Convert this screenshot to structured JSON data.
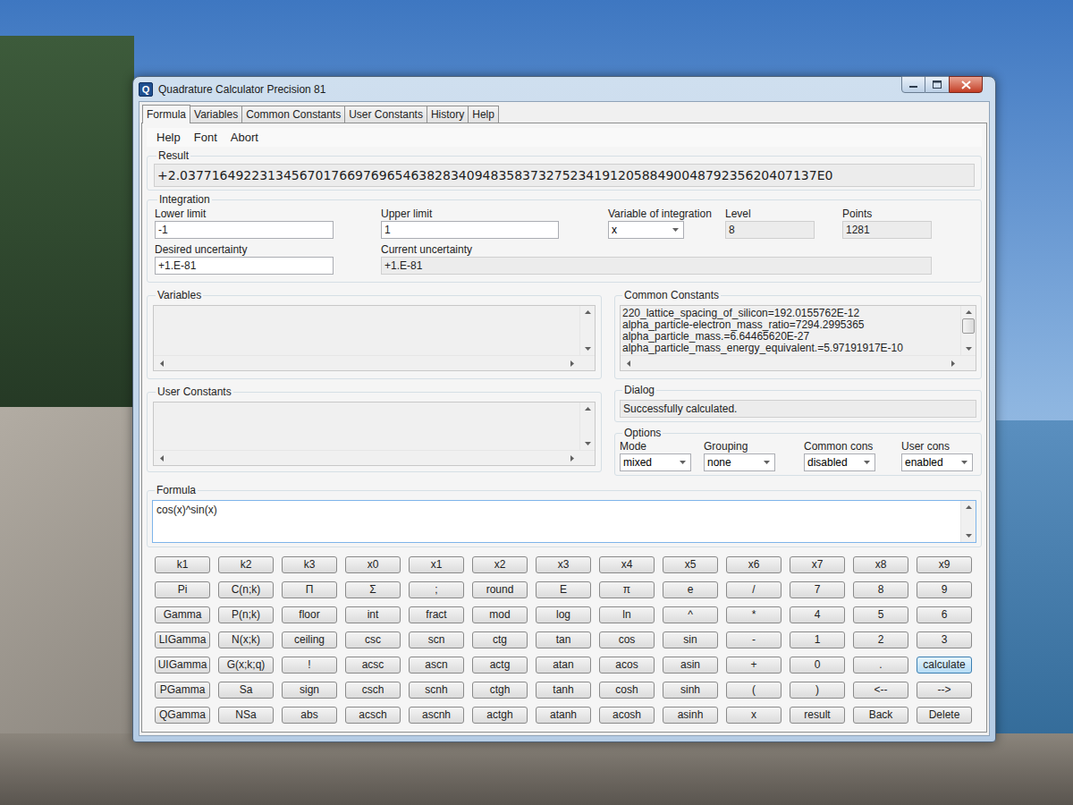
{
  "window": {
    "title": "Quadrature Calculator Precision 81",
    "icon": "Q"
  },
  "tabs": [
    {
      "label": "Formula",
      "selected": true
    },
    {
      "label": "Variables",
      "selected": false
    },
    {
      "label": "Common Constants",
      "selected": false
    },
    {
      "label": "User Constants",
      "selected": false
    },
    {
      "label": "History",
      "selected": false
    },
    {
      "label": "Help",
      "selected": false
    }
  ],
  "menu": [
    "Help",
    "Font",
    "Abort"
  ],
  "result": {
    "label": "Result",
    "value": "+2.03771649223134567017669769654638283409483583732752341912058849004879235620407137E0"
  },
  "integration": {
    "label": "Integration",
    "lower_limit": {
      "label": "Lower limit",
      "value": "-1"
    },
    "upper_limit": {
      "label": "Upper limit",
      "value": "1"
    },
    "variable": {
      "label": "Variable of integration",
      "value": "x"
    },
    "level": {
      "label": "Level",
      "value": "8"
    },
    "points": {
      "label": "Points",
      "value": "1281"
    },
    "desired_uncertainty": {
      "label": "Desired uncertainty",
      "value": "+1.E-81"
    },
    "current_uncertainty": {
      "label": "Current uncertainty",
      "value": "+1.E-81"
    }
  },
  "variables": {
    "label": "Variables",
    "items": [],
    "scrollable": false
  },
  "common_constants": {
    "label": "Common Constants",
    "items": [
      "220_lattice_spacing_of_silicon=192.0155762E-12",
      "alpha_particle-electron_mass_ratio=7294.2995365",
      "alpha_particle_mass.=6.64465620E-27",
      "alpha_particle_mass_energy_equivalent.=5.97191917E-10"
    ],
    "scrollable": true
  },
  "user_constants": {
    "label": "User Constants",
    "items": [],
    "scrollable": false
  },
  "dialog": {
    "label": "Dialog",
    "message": "Successfully calculated."
  },
  "options": {
    "label": "Options",
    "fields": [
      {
        "label": "Mode",
        "value": "mixed"
      },
      {
        "label": "Grouping",
        "value": "none"
      },
      {
        "label": "Common cons",
        "value": "disabled"
      },
      {
        "label": "User cons",
        "value": "enabled"
      }
    ]
  },
  "formula": {
    "label": "Formula",
    "value": "cos(x)^sin(x)"
  },
  "keypad": [
    [
      {
        "label": "k1",
        "selected": false
      },
      {
        "label": "k2",
        "selected": false
      },
      {
        "label": "k3",
        "selected": false
      },
      {
        "label": "x0",
        "selected": false
      },
      {
        "label": "x1",
        "selected": false
      },
      {
        "label": "x2",
        "selected": false
      },
      {
        "label": "x3",
        "selected": false
      },
      {
        "label": "x4",
        "selected": false
      },
      {
        "label": "x5",
        "selected": false
      },
      {
        "label": "x6",
        "selected": false
      },
      {
        "label": "x7",
        "selected": false
      },
      {
        "label": "x8",
        "selected": false
      },
      {
        "label": "x9",
        "selected": false
      }
    ],
    [
      {
        "label": "Pi",
        "selected": false
      },
      {
        "label": "C(n;k)",
        "selected": false
      },
      {
        "label": "Π",
        "selected": false
      },
      {
        "label": "Σ",
        "selected": false
      },
      {
        "label": ";",
        "selected": false
      },
      {
        "label": "round",
        "selected": false
      },
      {
        "label": "E",
        "selected": false
      },
      {
        "label": "π",
        "selected": false
      },
      {
        "label": "e",
        "selected": false
      },
      {
        "label": "/",
        "selected": false
      },
      {
        "label": "7",
        "selected": false
      },
      {
        "label": "8",
        "selected": false
      },
      {
        "label": "9",
        "selected": false
      }
    ],
    [
      {
        "label": "Gamma",
        "selected": false
      },
      {
        "label": "P(n;k)",
        "selected": false
      },
      {
        "label": "floor",
        "selected": false
      },
      {
        "label": "int",
        "selected": false
      },
      {
        "label": "fract",
        "selected": false
      },
      {
        "label": "mod",
        "selected": false
      },
      {
        "label": "log",
        "selected": false
      },
      {
        "label": "ln",
        "selected": false
      },
      {
        "label": "^",
        "selected": false
      },
      {
        "label": "*",
        "selected": false
      },
      {
        "label": "4",
        "selected": false
      },
      {
        "label": "5",
        "selected": false
      },
      {
        "label": "6",
        "selected": false
      }
    ],
    [
      {
        "label": "LIGamma",
        "selected": false
      },
      {
        "label": "N(x;k)",
        "selected": false
      },
      {
        "label": "ceiling",
        "selected": false
      },
      {
        "label": "csc",
        "selected": false
      },
      {
        "label": "scn",
        "selected": false
      },
      {
        "label": "ctg",
        "selected": false
      },
      {
        "label": "tan",
        "selected": false
      },
      {
        "label": "cos",
        "selected": false
      },
      {
        "label": "sin",
        "selected": false
      },
      {
        "label": "-",
        "selected": false
      },
      {
        "label": "1",
        "selected": false
      },
      {
        "label": "2",
        "selected": false
      },
      {
        "label": "3",
        "selected": false
      }
    ],
    [
      {
        "label": "UIGamma",
        "selected": false
      },
      {
        "label": "G(x;k;q)",
        "selected": false
      },
      {
        "label": "!",
        "selected": false
      },
      {
        "label": "acsc",
        "selected": false
      },
      {
        "label": "ascn",
        "selected": false
      },
      {
        "label": "actg",
        "selected": false
      },
      {
        "label": "atan",
        "selected": false
      },
      {
        "label": "acos",
        "selected": false
      },
      {
        "label": "asin",
        "selected": false
      },
      {
        "label": "+",
        "selected": false
      },
      {
        "label": "0",
        "selected": false
      },
      {
        "label": ".",
        "selected": false
      },
      {
        "label": "calculate",
        "selected": true
      }
    ],
    [
      {
        "label": "PGamma",
        "selected": false
      },
      {
        "label": "Sa",
        "selected": false
      },
      {
        "label": "sign",
        "selected": false
      },
      {
        "label": "csch",
        "selected": false
      },
      {
        "label": "scnh",
        "selected": false
      },
      {
        "label": "ctgh",
        "selected": false
      },
      {
        "label": "tanh",
        "selected": false
      },
      {
        "label": "cosh",
        "selected": false
      },
      {
        "label": "sinh",
        "selected": false
      },
      {
        "label": "(",
        "selected": false
      },
      {
        "label": ")",
        "selected": false
      },
      {
        "label": "<--",
        "selected": false
      },
      {
        "label": "-->",
        "selected": false
      }
    ],
    [
      {
        "label": "QGamma",
        "selected": false
      },
      {
        "label": "NSa",
        "selected": false
      },
      {
        "label": "abs",
        "selected": false
      },
      {
        "label": "acsch",
        "selected": false
      },
      {
        "label": "ascnh",
        "selected": false
      },
      {
        "label": "actgh",
        "selected": false
      },
      {
        "label": "atanh",
        "selected": false
      },
      {
        "label": "acosh",
        "selected": false
      },
      {
        "label": "asinh",
        "selected": false
      },
      {
        "label": "x",
        "selected": false
      },
      {
        "label": "result",
        "selected": false
      },
      {
        "label": "Back",
        "selected": false
      },
      {
        "label": "Delete",
        "selected": false
      }
    ]
  ]
}
